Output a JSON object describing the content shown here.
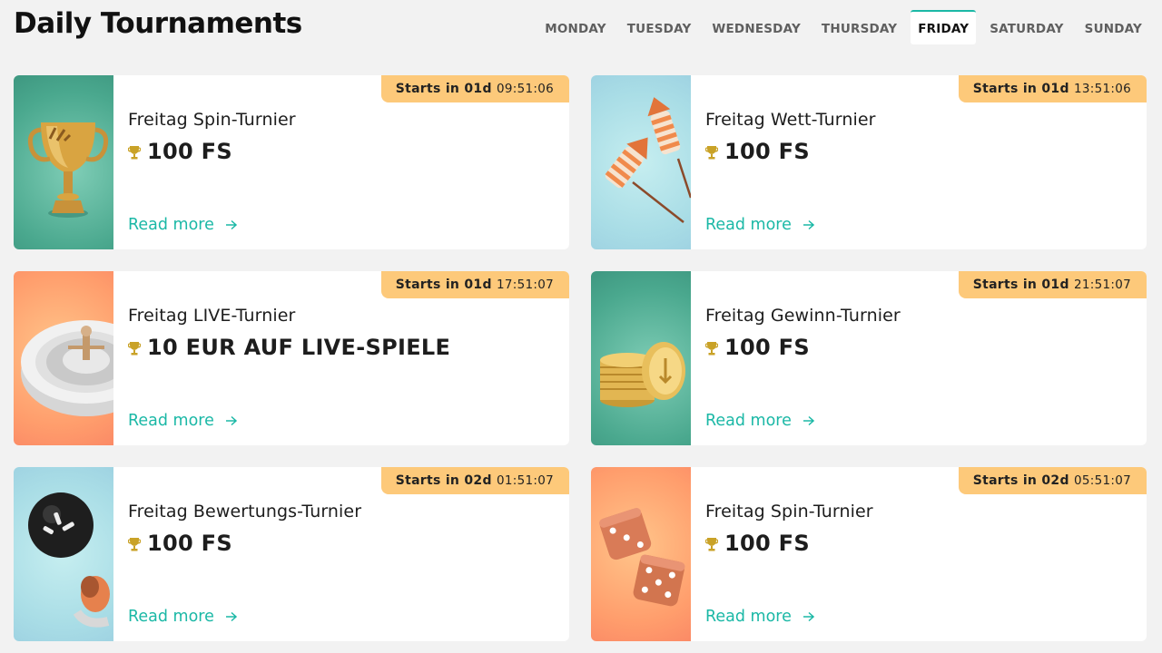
{
  "header": {
    "title": "Daily Tournaments"
  },
  "days": [
    "MONDAY",
    "TUESDAY",
    "WEDNESDAY",
    "THURSDAY",
    "FRIDAY",
    "SATURDAY",
    "SUNDAY"
  ],
  "active_day": "FRIDAY",
  "colors": {
    "accent": "#1bb8a6",
    "badge": "#fdc97a",
    "trophy": "#c9a227"
  },
  "cards": [
    {
      "starts_label": "Starts in",
      "days": "01d",
      "time": "09:51:06",
      "title": "Freitag Spin-Turnier",
      "prize": "100 FS",
      "read_more": "Read more",
      "image": "trophy-illustration"
    },
    {
      "starts_label": "Starts in",
      "days": "01d",
      "time": "13:51:06",
      "title": "Freitag Wett-Turnier",
      "prize": "100 FS",
      "read_more": "Read more",
      "image": "rockets-illustration"
    },
    {
      "starts_label": "Starts in",
      "days": "01d",
      "time": "17:51:07",
      "title": "Freitag LIVE-Turnier",
      "prize": "10 EUR AUF LIVE-SPIELE",
      "read_more": "Read more",
      "image": "roulette-illustration"
    },
    {
      "starts_label": "Starts in",
      "days": "01d",
      "time": "21:51:07",
      "title": "Freitag Gewinn-Turnier",
      "prize": "100 FS",
      "read_more": "Read more",
      "image": "coins-illustration"
    },
    {
      "starts_label": "Starts in",
      "days": "02d",
      "time": "01:51:07",
      "title": "Freitag Bewertungs-Turnier",
      "prize": "100 FS",
      "read_more": "Read more",
      "image": "ball-cannon-illustration"
    },
    {
      "starts_label": "Starts in",
      "days": "02d",
      "time": "05:51:07",
      "title": "Freitag Spin-Turnier",
      "prize": "100 FS",
      "read_more": "Read more",
      "image": "dice-illustration"
    }
  ]
}
